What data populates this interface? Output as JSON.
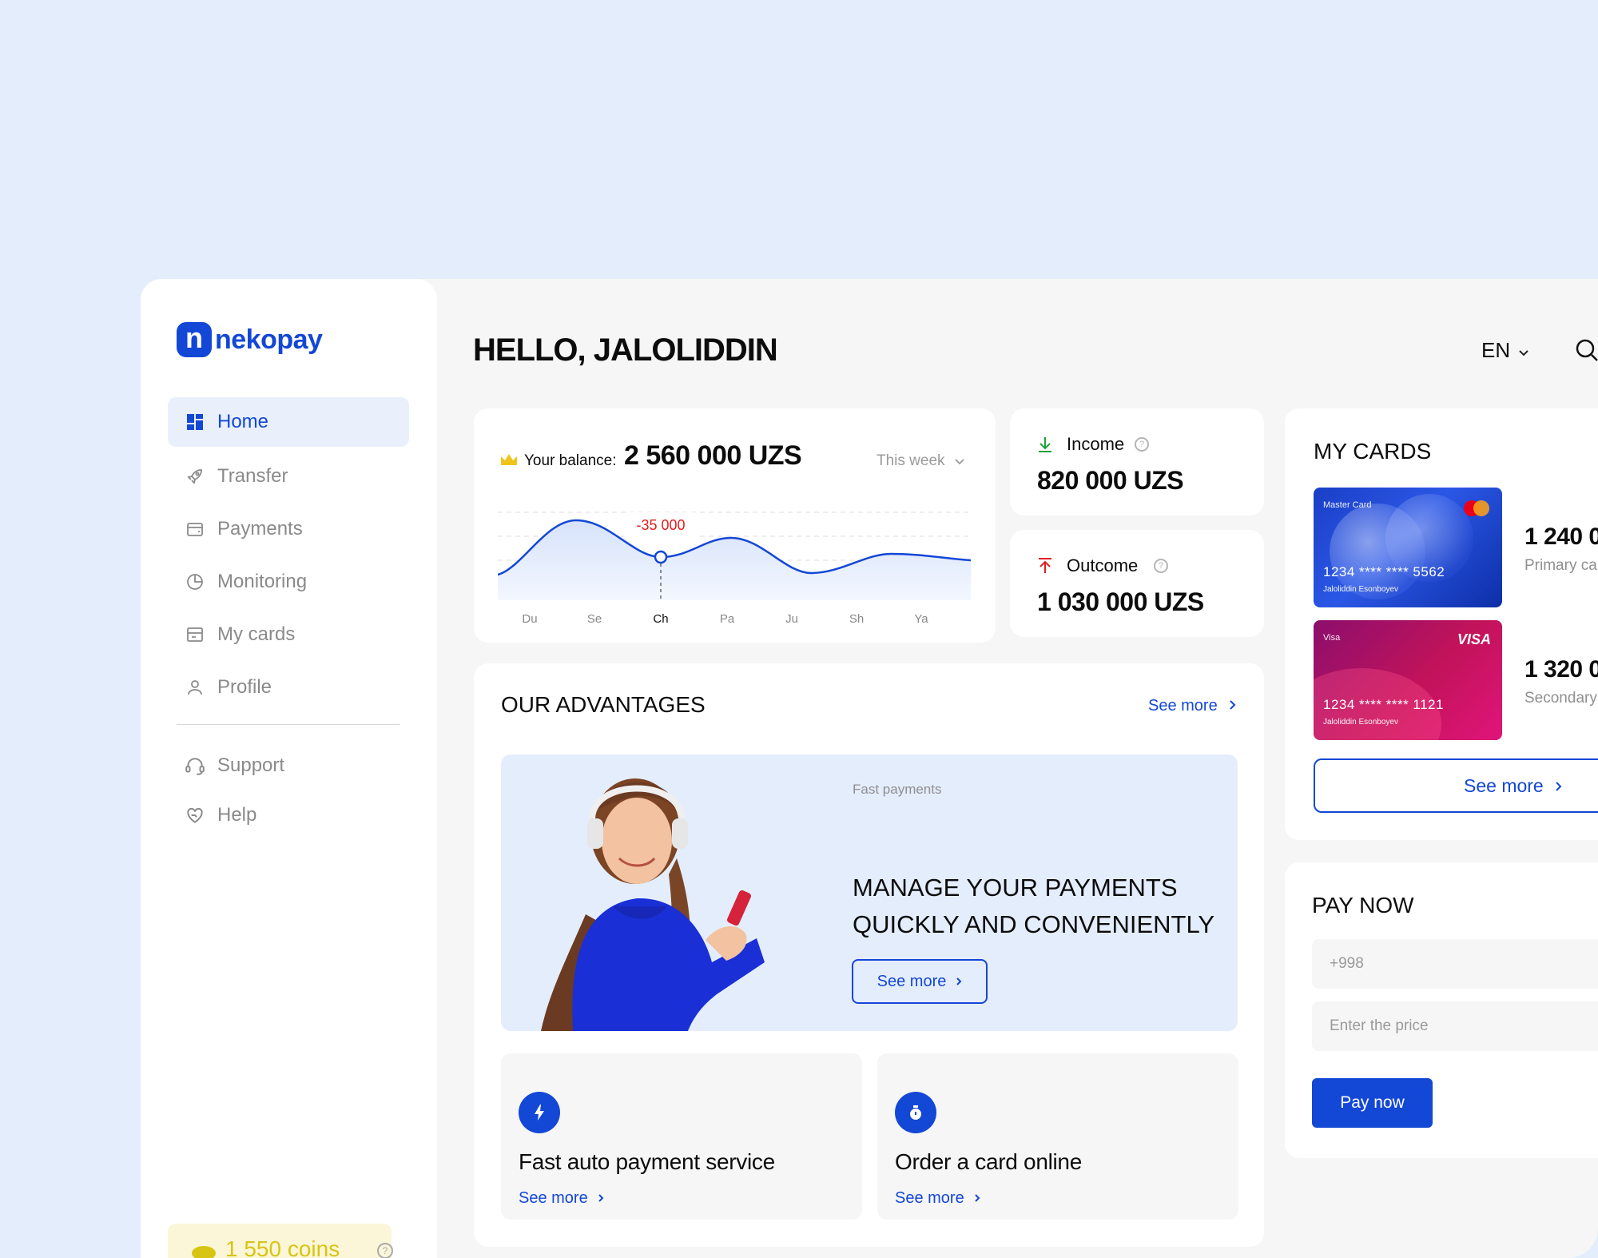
{
  "brand": {
    "logo_letter": "n",
    "name": "nekopay",
    "color": "#1347d6"
  },
  "sidebar": {
    "items": [
      {
        "label": "Home",
        "icon": "grid-icon",
        "active": true
      },
      {
        "label": "Transfer",
        "icon": "rocket-icon"
      },
      {
        "label": "Payments",
        "icon": "wallet-icon"
      },
      {
        "label": "Monitoring",
        "icon": "pie-chart-icon"
      },
      {
        "label": "My cards",
        "icon": "card-icon"
      },
      {
        "label": "Profile",
        "icon": "user-icon"
      }
    ],
    "secondary": [
      {
        "label": "Support",
        "icon": "headset-icon"
      },
      {
        "label": "Help",
        "icon": "heart-hand-icon"
      }
    ],
    "coins": "1 550 coins"
  },
  "header": {
    "greeting": "HELLO, JALOLIDDIN",
    "language": "EN"
  },
  "balance": {
    "label": "Your balance:",
    "value": "2 560 000 UZS",
    "period": "This week",
    "tooltip": "-35 000",
    "days": [
      "Du",
      "Se",
      "Ch",
      "Pa",
      "Ju",
      "Sh",
      "Ya"
    ],
    "selected_day": "Ch"
  },
  "income": {
    "label": "Income",
    "value": "820 000 UZS",
    "color": "#1fa33b"
  },
  "outcome": {
    "label": "Outcome",
    "value": "1 030 000 UZS",
    "color": "#e11d1d"
  },
  "advantages": {
    "title": "OUR ADVANTAGES",
    "see_more": "See more",
    "banner": {
      "tag": "Fast payments",
      "line1": "MANAGE YOUR PAYMENTS",
      "line2": "QUICKLY AND CONVENIENTLY",
      "button": "See more"
    },
    "features": [
      {
        "title": "Fast auto payment service",
        "link": "See more",
        "icon": "lightning-icon"
      },
      {
        "title": "Order a card online",
        "link": "See more",
        "icon": "stopwatch-icon"
      }
    ]
  },
  "my_cards": {
    "title": "MY CARDS",
    "cards": [
      {
        "type": "Master Card",
        "number": "1234  ****  ****  5562",
        "holder": "Jaloliddin Esonboyev",
        "amount": "1 240 0",
        "sub": "Primary car"
      },
      {
        "type": "Visa",
        "brand": "VISA",
        "number": "1234  ****  ****  1121",
        "holder": "Jaloliddin Esonboyev",
        "amount": "1 320 0",
        "sub": "Secondary"
      }
    ],
    "see_more": "See more"
  },
  "pay_now": {
    "title": "PAY NOW",
    "phone_placeholder": "+998",
    "price_placeholder": "Enter the price",
    "button": "Pay now"
  }
}
